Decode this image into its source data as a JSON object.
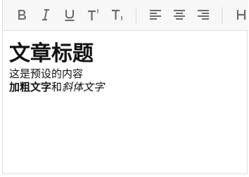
{
  "toolbar": {
    "buttons": [
      {
        "name": "bold",
        "icon": "bold-icon"
      },
      {
        "name": "italic",
        "icon": "italic-icon"
      },
      {
        "name": "underline",
        "icon": "underline-icon"
      },
      {
        "name": "superscript",
        "icon": "superscript-icon"
      },
      {
        "name": "subscript",
        "icon": "subscript-icon"
      },
      {
        "name": "align-left",
        "icon": "align-left-icon"
      },
      {
        "name": "align-center",
        "icon": "align-center-icon"
      },
      {
        "name": "align-right",
        "icon": "align-right-icon"
      },
      {
        "name": "heading",
        "icon": "heading-icon"
      }
    ],
    "icon_color": "#6b6b6b"
  },
  "content": {
    "heading": "文章标题",
    "paragraph": "这是预设的内容",
    "bold_text": "加粗文字",
    "connector": "和",
    "italic_text": "斜体文字"
  }
}
